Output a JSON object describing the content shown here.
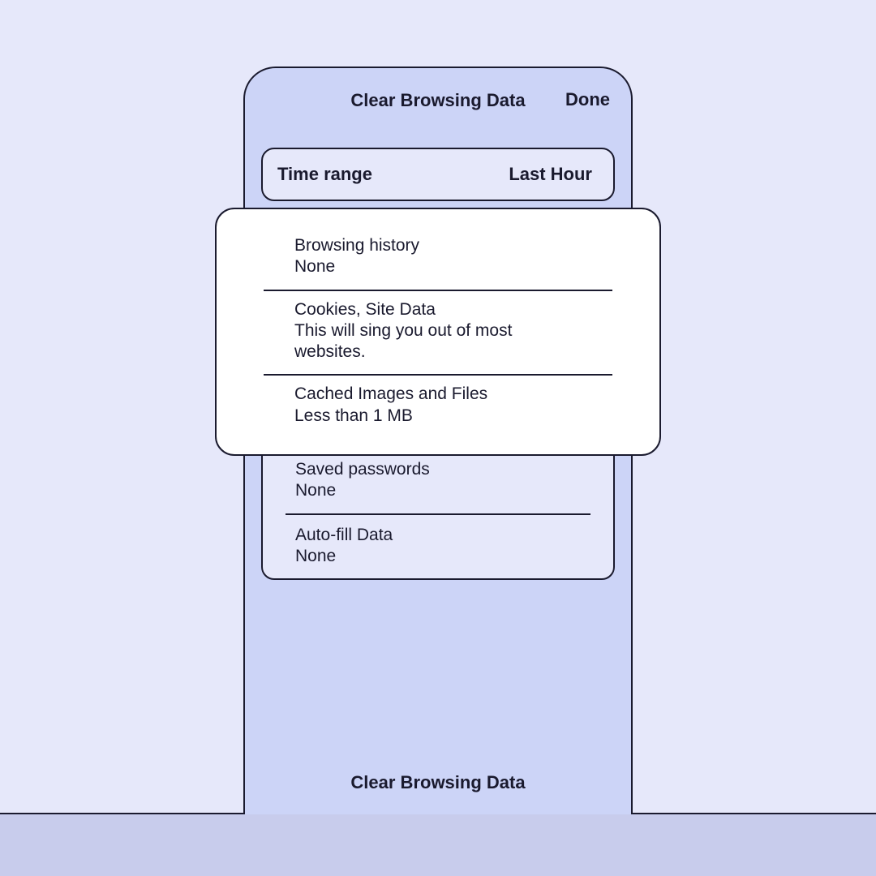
{
  "header": {
    "title": "Clear Browsing Data",
    "done": "Done"
  },
  "timerange": {
    "label": "Time range",
    "value": "Last Hour"
  },
  "items": [
    {
      "title": "Browsing history",
      "sub": "None"
    },
    {
      "title": "Cookies, Site Data",
      "sub": "This will sing you out of most websites."
    },
    {
      "title": "Cached Images and Files",
      "sub": "Less than 1 MB"
    },
    {
      "title": "Saved passwords",
      "sub": "None"
    },
    {
      "title": "Auto-fill Data",
      "sub": "None"
    }
  ],
  "footer": {
    "clear": "Clear Browsing Data"
  }
}
